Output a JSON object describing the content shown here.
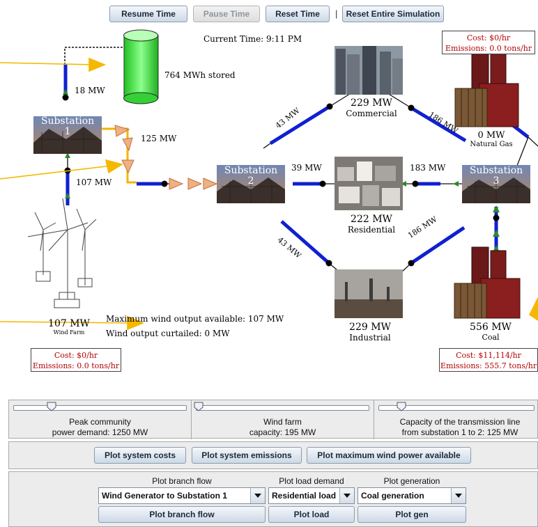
{
  "toolbar": {
    "resume": "Resume Time",
    "pause": "Pause Time",
    "reset": "Reset Time",
    "separator": "|",
    "reset_all": "Reset Entire Simulation"
  },
  "current_time": "Current Time: 9:11 PM",
  "storage": {
    "label": "764 MWh stored"
  },
  "substations": {
    "s1": {
      "name": "Substation",
      "num": "1"
    },
    "s2": {
      "name": "Substation",
      "num": "2"
    },
    "s3": {
      "name": "Substation",
      "num": "3"
    }
  },
  "flows": {
    "storage_s1": "18 MW",
    "s1_s2": "125 MW",
    "wind_s1": "107 MW",
    "s2_commercial": "43 MW",
    "s2_residential": "39 MW",
    "s2_industrial": "43 MW",
    "s3_commercial": "186 MW",
    "s3_residential": "183 MW",
    "s3_industrial": "186 MW"
  },
  "loads": {
    "commercial": {
      "mw": "229 MW",
      "name": "Commercial"
    },
    "residential": {
      "mw": "222 MW",
      "name": "Residential"
    },
    "industrial": {
      "mw": "229 MW",
      "name": "Industrial"
    }
  },
  "generators": {
    "wind": {
      "mw": "107 MW",
      "name": "Wind Farm",
      "cost": "Cost: $0/hr",
      "emissions": "Emissions: 0.0 tons/hr"
    },
    "gas": {
      "mw": "0 MW",
      "name": "Natural Gas",
      "cost": "Cost: $0/hr",
      "emissions": "Emissions: 0.0 tons/hr"
    },
    "coal": {
      "mw": "556 MW",
      "name": "Coal",
      "cost": "Cost: $11,114/hr",
      "emissions": "Emissions: 555.7 tons/hr"
    }
  },
  "wind_info": {
    "max": "Maximum wind output available: 107 MW",
    "curtailed": "Wind output curtailed: 0 MW"
  },
  "sliders": {
    "demand": {
      "line1": "Peak community",
      "line2": "power demand: 1250 MW"
    },
    "wind": {
      "line1": "Wind farm",
      "line2": "capacity: 195 MW"
    },
    "line": {
      "line1": "Capacity of the transmission line",
      "line2": "from substation 1 to 2: 125 MW"
    }
  },
  "plot_buttons": {
    "costs": "Plot system costs",
    "emissions": "Plot system emissions",
    "max_wind": "Plot maximum wind power available"
  },
  "branch": {
    "label": "Plot branch flow",
    "selected": "Wind Generator to Substation 1",
    "button": "Plot branch flow"
  },
  "load": {
    "label": "Plot load demand",
    "selected": "Residential load",
    "button": "Plot load"
  },
  "generation": {
    "label": "Plot generation",
    "selected": "Coal generation",
    "button": "Plot gen"
  },
  "colors": {
    "accent_line": "#1020d0",
    "cost_text": "#b30000",
    "storage": "#33dd33",
    "callout": "#f5b800"
  }
}
